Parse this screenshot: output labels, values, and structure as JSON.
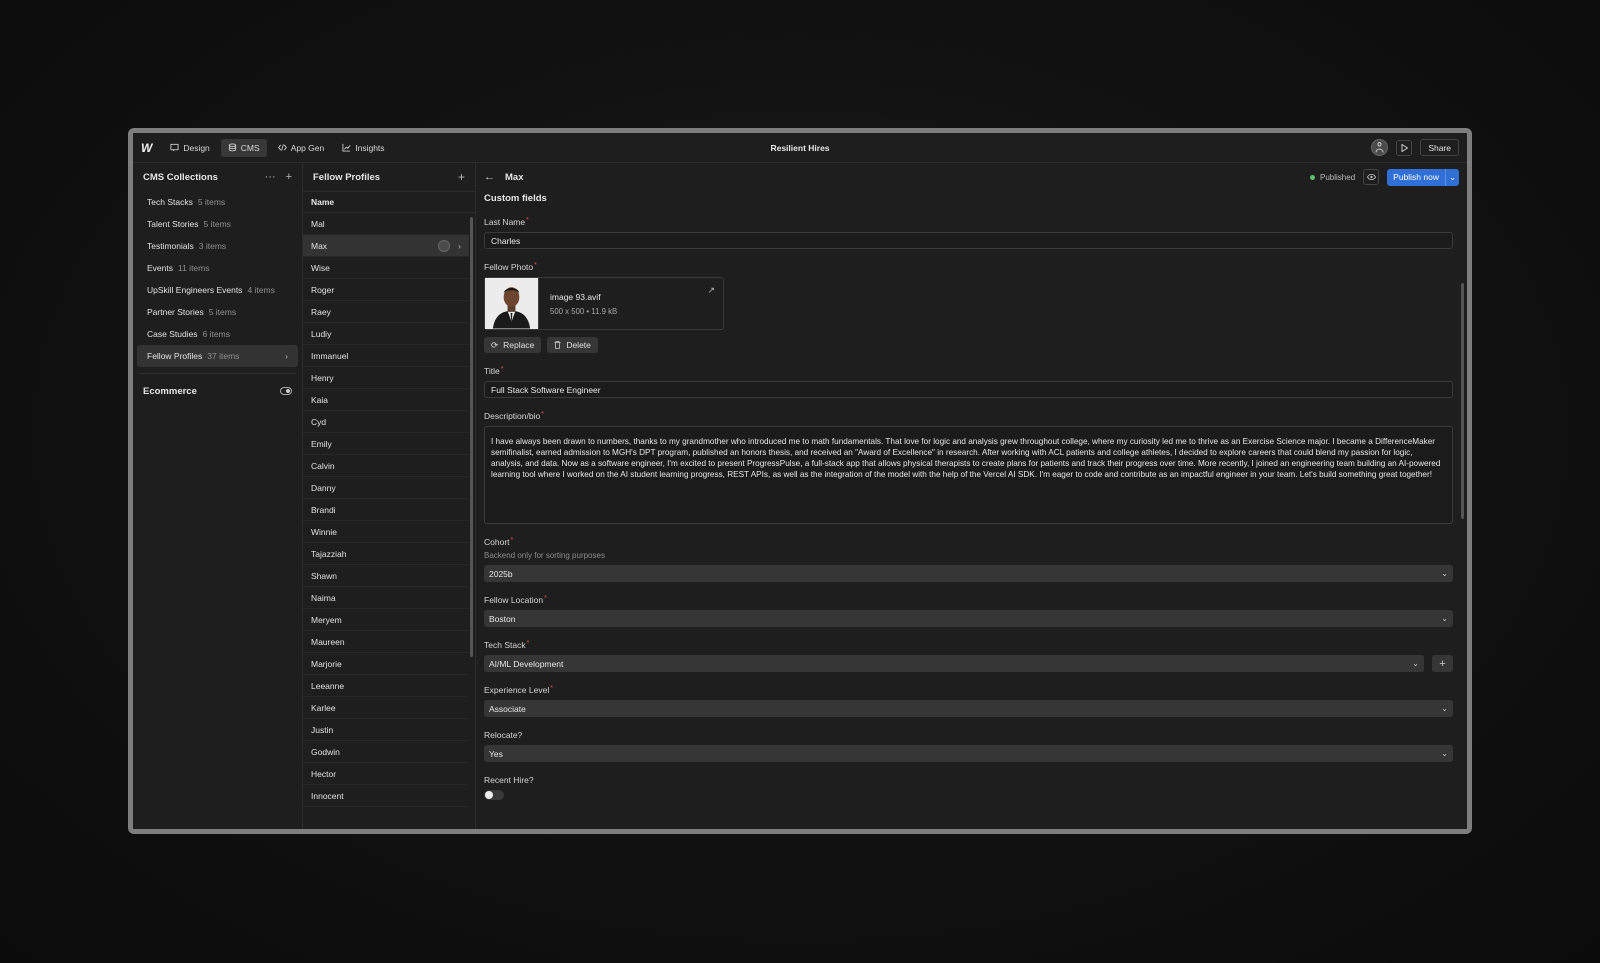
{
  "topbar": {
    "logo": "W",
    "nav": [
      {
        "label": "Design",
        "icon": "design-icon"
      },
      {
        "label": "CMS",
        "icon": "database-icon"
      },
      {
        "label": "App Gen",
        "icon": "code-icon"
      },
      {
        "label": "Insights",
        "icon": "chart-icon"
      }
    ],
    "app_title": "Resilient Hires",
    "share_label": "Share"
  },
  "collections": {
    "title": "CMS Collections",
    "items": [
      {
        "name": "Tech Stacks",
        "count": "5 items"
      },
      {
        "name": "Talent Stories",
        "count": "5 items"
      },
      {
        "name": "Testimonials",
        "count": "3 items"
      },
      {
        "name": "Events",
        "count": "11 items"
      },
      {
        "name": "UpSkill Engineers Events",
        "count": "4 items"
      },
      {
        "name": "Partner Stories",
        "count": "5 items"
      },
      {
        "name": "Case Studies",
        "count": "6 items"
      },
      {
        "name": "Fellow Profiles",
        "count": "37 items"
      }
    ],
    "ecommerce_label": "Ecommerce"
  },
  "profiles": {
    "title": "Fellow Profiles",
    "column_header": "Name",
    "rows": [
      "Mal",
      "Max",
      "Wise",
      "Roger",
      "Raey",
      "Ludiy",
      "Immanuel",
      "Henry",
      "Kaia",
      "Cyd",
      "Emily",
      "Calvin",
      "Danny",
      "Brandi",
      "Winnie",
      "Tajazziah",
      "Shawn",
      "Naima",
      "Meryem",
      "Maureen",
      "Marjorie",
      "Leeanne",
      "Karlee",
      "Justin",
      "Godwin",
      "Hector",
      "Innocent"
    ]
  },
  "editor": {
    "item_name": "Max",
    "status": "Published",
    "publish_label": "Publish now",
    "section_title": "Custom fields",
    "last_name": {
      "label": "Last Name",
      "value": "Charles"
    },
    "photo": {
      "label": "Fellow Photo",
      "filename": "image 93.avif",
      "meta": "500 x 500 • 11.9 kB",
      "replace_label": "Replace",
      "delete_label": "Delete"
    },
    "title_field": {
      "label": "Title",
      "value": "Full Stack Software Engineer"
    },
    "bio": {
      "label": "Description/bio",
      "value": "I have always been drawn to numbers, thanks to my grandmother who introduced me to math fundamentals. That love for logic and analysis grew throughout college, where my curiosity led me to thrive as an Exercise Science major. I became a DifferenceMaker semifinalist, earned admission to MGH's DPT program, published an honors thesis, and received an \"Award of Excellence\" in research. After working with ACL patients and college athletes, I decided to explore careers that could blend my passion for logic, analysis, and data. Now as a software engineer, I'm excited to present ProgressPulse, a full-stack app that allows physical therapists to create plans for patients and track their progress over time. More recently, I joined an engineering team building an AI-powered learning tool where I worked on the AI student learning progress, REST APIs, as well as the integration of the model with the help of the Vercel AI SDK. I'm eager to code and contribute as an impactful engineer in your team. Let's build something great together!"
    },
    "cohort": {
      "label": "Cohort",
      "helper": "Backend only for sorting purposes",
      "value": "2025b"
    },
    "location": {
      "label": "Fellow Location",
      "value": "Boston"
    },
    "tech_stack": {
      "label": "Tech Stack",
      "value": "AI/ML Development"
    },
    "experience": {
      "label": "Experience Level",
      "value": "Associate"
    },
    "relocate": {
      "label": "Relocate?",
      "value": "Yes"
    },
    "recent_hire": {
      "label": "Recent Hire?",
      "value": false
    }
  },
  "colors": {
    "accent": "#2f6fd6",
    "published": "#5ac26e",
    "required": "#e05555"
  }
}
